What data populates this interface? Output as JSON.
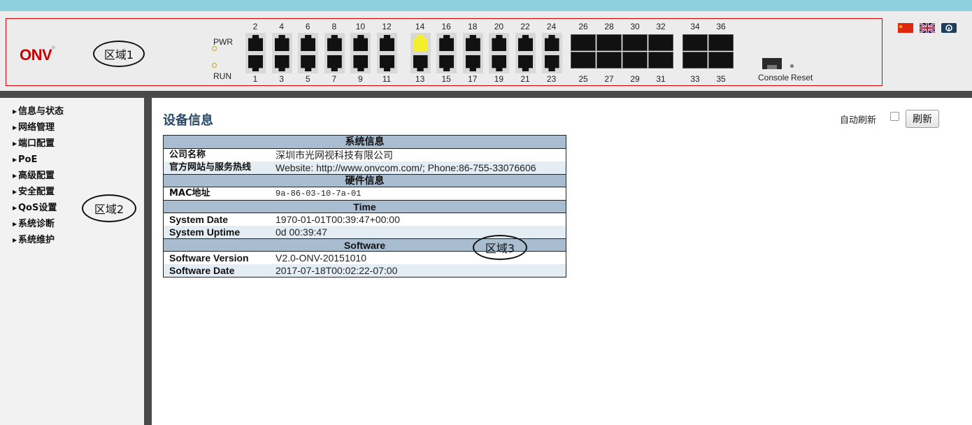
{
  "header": {
    "logo": "ONV",
    "logo_mark": "®",
    "region_label": "区域1",
    "pwr_label": "PWR",
    "run_label": "RUN",
    "ports_top": [
      "2",
      "4",
      "6",
      "8",
      "10",
      "12",
      "14",
      "16",
      "18",
      "20",
      "22",
      "24"
    ],
    "ports_bottom": [
      "1",
      "3",
      "5",
      "7",
      "9",
      "11",
      "13",
      "15",
      "17",
      "19",
      "21",
      "23"
    ],
    "sfp_top": [
      "26",
      "28",
      "30",
      "32",
      "34",
      "36"
    ],
    "sfp_bottom": [
      "25",
      "27",
      "29",
      "31",
      "33",
      "35"
    ],
    "active_port": "14",
    "console_label": "Console",
    "reset_label": "Reset",
    "flags": [
      "cn-flag-icon",
      "uk-flag-icon",
      "help-icon"
    ]
  },
  "sidebar": {
    "region_label": "区域2",
    "items": [
      {
        "label": "信息与状态"
      },
      {
        "label": "网络管理"
      },
      {
        "label": "端口配置"
      },
      {
        "label": "PoE"
      },
      {
        "label": "高级配置"
      },
      {
        "label": "安全配置"
      },
      {
        "label": "QoS设置"
      },
      {
        "label": "系统诊断"
      },
      {
        "label": "系统维护"
      }
    ]
  },
  "main": {
    "title": "设备信息",
    "auto_refresh_label": "自动刷新",
    "auto_refresh_checked": false,
    "refresh_button": "刷新",
    "region_label": "区域3",
    "sections": [
      {
        "title": "系统信息",
        "rows": [
          {
            "key": "公司名称",
            "value": "深圳市光网视科技有限公司"
          },
          {
            "key": "官方网站与服务热线",
            "value": "Website: http://www.onvcom.com/; Phone:86-755-33076606"
          }
        ]
      },
      {
        "title": "硬件信息",
        "rows": [
          {
            "key": "MAC地址",
            "value": "9a-86-03-10-7a-01"
          }
        ]
      },
      {
        "title": "Time",
        "rows": [
          {
            "key": "System Date",
            "value": "1970-01-01T00:39:47+00:00"
          },
          {
            "key": "System Uptime",
            "value": "0d 00:39:47"
          }
        ]
      },
      {
        "title": "Software",
        "rows": [
          {
            "key": "Software Version",
            "value": "V2.0-ONV-20151010"
          },
          {
            "key": "Software Date",
            "value": "2017-07-18T00:02:22-07:00"
          }
        ]
      }
    ]
  },
  "colors": {
    "header_bg": "#ececec",
    "panel_border": "#d40000",
    "section_head": "#a9bdd1",
    "row_alt": "#e4ecf4",
    "logo": "#cc0000"
  }
}
